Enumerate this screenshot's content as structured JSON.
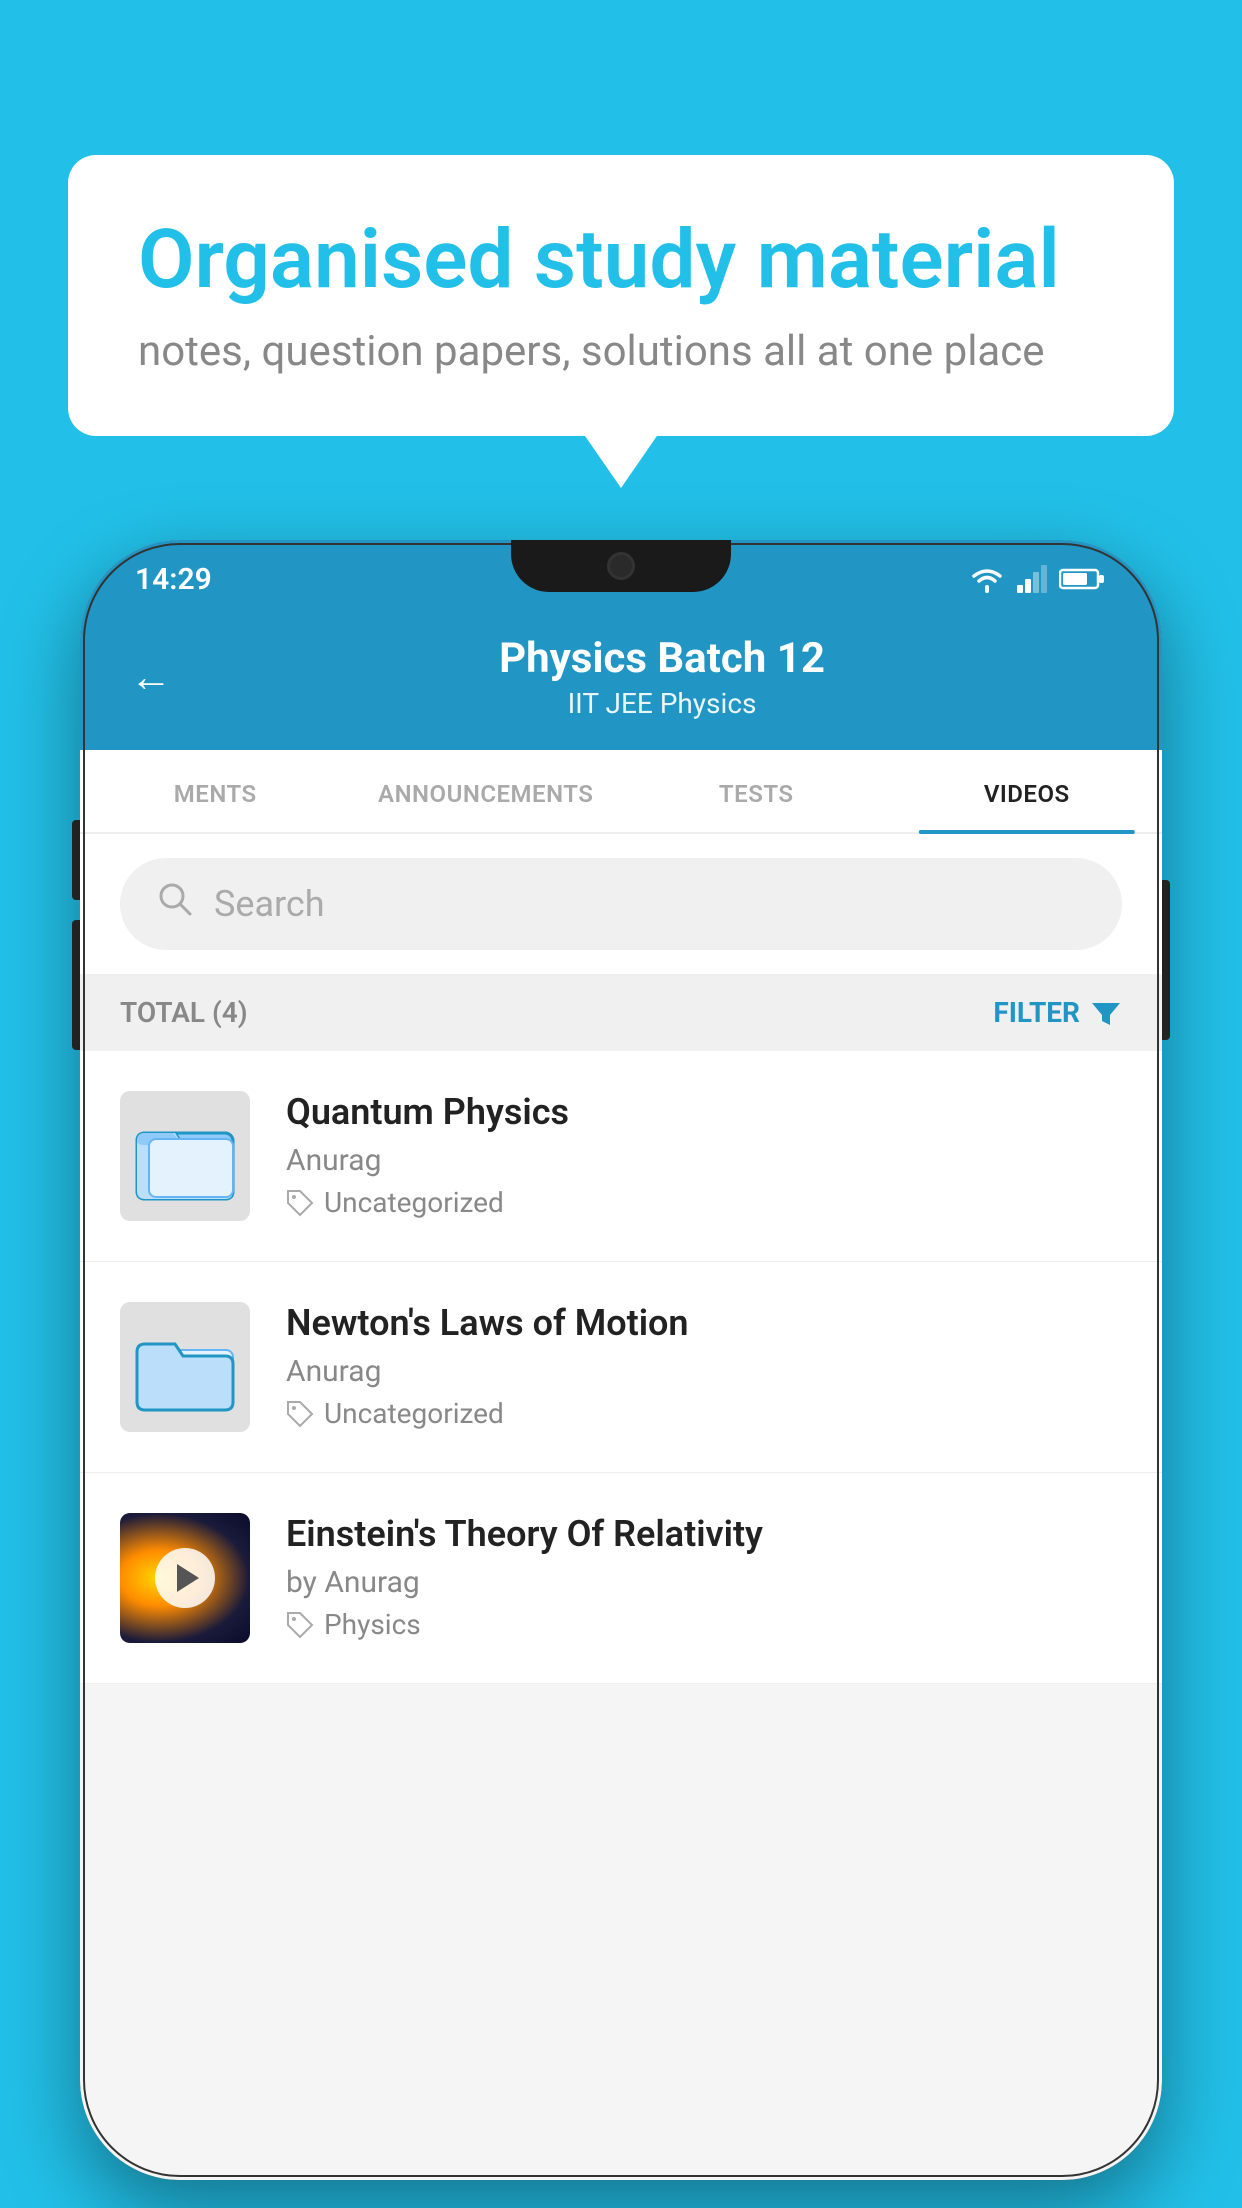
{
  "page": {
    "background_color": "#22C0E8"
  },
  "speech_bubble": {
    "title": "Organised study material",
    "subtitle": "notes, question papers, solutions all at one place"
  },
  "phone": {
    "status_bar": {
      "time": "14:29"
    },
    "header": {
      "title": "Physics Batch 12",
      "subtitle": "IIT JEE   Physics",
      "back_label": "←"
    },
    "tabs": [
      {
        "label": "MENTS",
        "active": false
      },
      {
        "label": "ANNOUNCEMENTS",
        "active": false
      },
      {
        "label": "TESTS",
        "active": false
      },
      {
        "label": "VIDEOS",
        "active": true
      }
    ],
    "search": {
      "placeholder": "Search"
    },
    "filter": {
      "total_label": "TOTAL (4)",
      "filter_label": "FILTER"
    },
    "videos": [
      {
        "title": "Quantum Physics",
        "author": "Anurag",
        "tag": "Uncategorized",
        "type": "folder",
        "has_thumbnail": false
      },
      {
        "title": "Newton's Laws of Motion",
        "author": "Anurag",
        "tag": "Uncategorized",
        "type": "folder",
        "has_thumbnail": false
      },
      {
        "title": "Einstein's Theory Of Relativity",
        "author": "by Anurag",
        "tag": "Physics",
        "type": "video",
        "has_thumbnail": true
      }
    ]
  }
}
